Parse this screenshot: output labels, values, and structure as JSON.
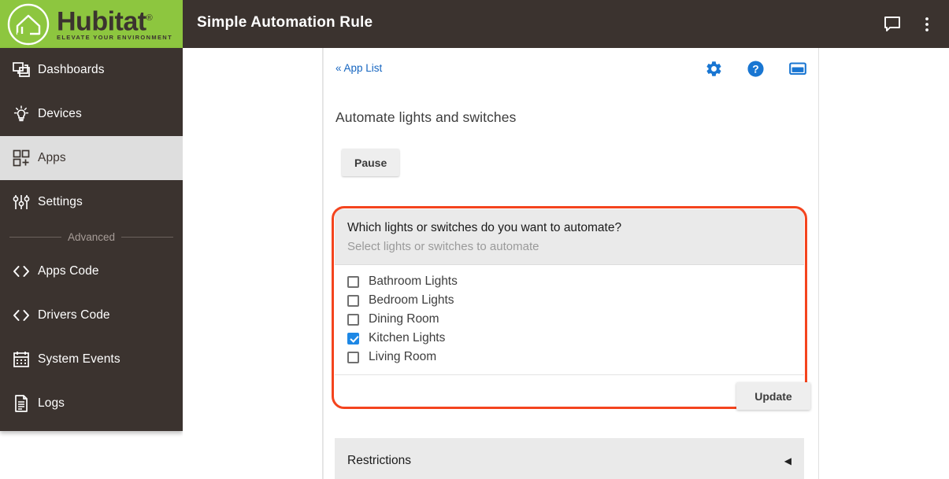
{
  "brand": {
    "name": "Hubitat",
    "registered": "®",
    "tagline": "ELEVATE YOUR ENVIRONMENT",
    "green": "#8dc63f",
    "dark": "#3b332f"
  },
  "topbar": {
    "title": "Simple Automation Rule",
    "icons": [
      {
        "name": "chat-icon",
        "glyph": "chat"
      },
      {
        "name": "overflow-menu-icon",
        "glyph": "dots"
      }
    ]
  },
  "sidebar": {
    "items": [
      {
        "label": "Dashboards",
        "icon": "dashboards-icon",
        "active": false
      },
      {
        "label": "Devices",
        "icon": "devices-icon",
        "active": false
      },
      {
        "label": "Apps",
        "icon": "apps-icon",
        "active": true
      },
      {
        "label": "Settings",
        "icon": "settings-icon",
        "active": false
      }
    ],
    "divider_label": "Advanced",
    "advanced_items": [
      {
        "label": "Apps Code",
        "icon": "code-icon"
      },
      {
        "label": "Drivers Code",
        "icon": "code-icon"
      },
      {
        "label": "System Events",
        "icon": "calendar-icon"
      },
      {
        "label": "Logs",
        "icon": "document-icon"
      }
    ]
  },
  "card": {
    "back_link": "« App List",
    "header_icons": [
      {
        "name": "gear-icon"
      },
      {
        "name": "help-icon"
      },
      {
        "name": "window-icon"
      }
    ],
    "page_subtitle": "Automate lights and switches",
    "pause_button": "Pause",
    "section": {
      "question": "Which lights or switches do you want to automate?",
      "hint": "Select lights or switches to automate",
      "options": [
        {
          "label": "Bathroom Lights",
          "checked": false
        },
        {
          "label": "Bedroom Lights",
          "checked": false
        },
        {
          "label": "Dining Room",
          "checked": false
        },
        {
          "label": "Kitchen Lights",
          "checked": true
        },
        {
          "label": "Living Room",
          "checked": false
        }
      ],
      "update_button": "Update",
      "highlight_color": "#f4441e"
    },
    "restrictions": {
      "label": "Restrictions",
      "arrow": "◀"
    }
  }
}
